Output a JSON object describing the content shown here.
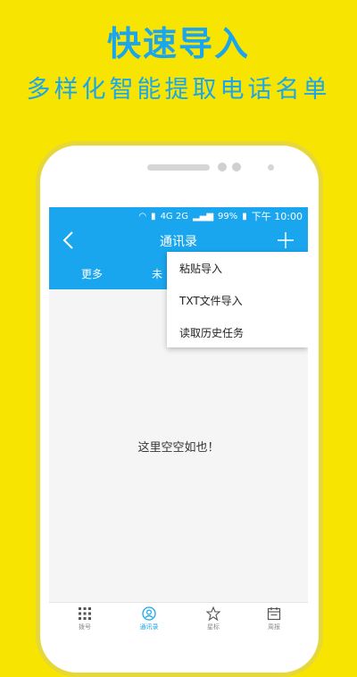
{
  "promo": {
    "headline": "快速导入",
    "subline": "多样化智能提取电话名单"
  },
  "status_bar": {
    "network": "4G 2G",
    "battery": "99%",
    "time": "下午 10:00"
  },
  "toolbar": {
    "title": "通讯录"
  },
  "tabs": {
    "more": "更多",
    "partial": "未"
  },
  "menu": {
    "items": [
      "粘贴导入",
      "TXT文件导入",
      "读取历史任务"
    ]
  },
  "content": {
    "empty_text": "这里空空如也！"
  },
  "bottom_nav": {
    "items": [
      {
        "label": "拨号",
        "icon": "dialpad-icon"
      },
      {
        "label": "通讯录",
        "icon": "contacts-icon"
      },
      {
        "label": "星标",
        "icon": "star-icon"
      },
      {
        "label": "周报",
        "icon": "calendar-icon"
      }
    ],
    "active": "通讯录"
  },
  "colors": {
    "background": "#f7e400",
    "accent": "#1aa6ee"
  }
}
